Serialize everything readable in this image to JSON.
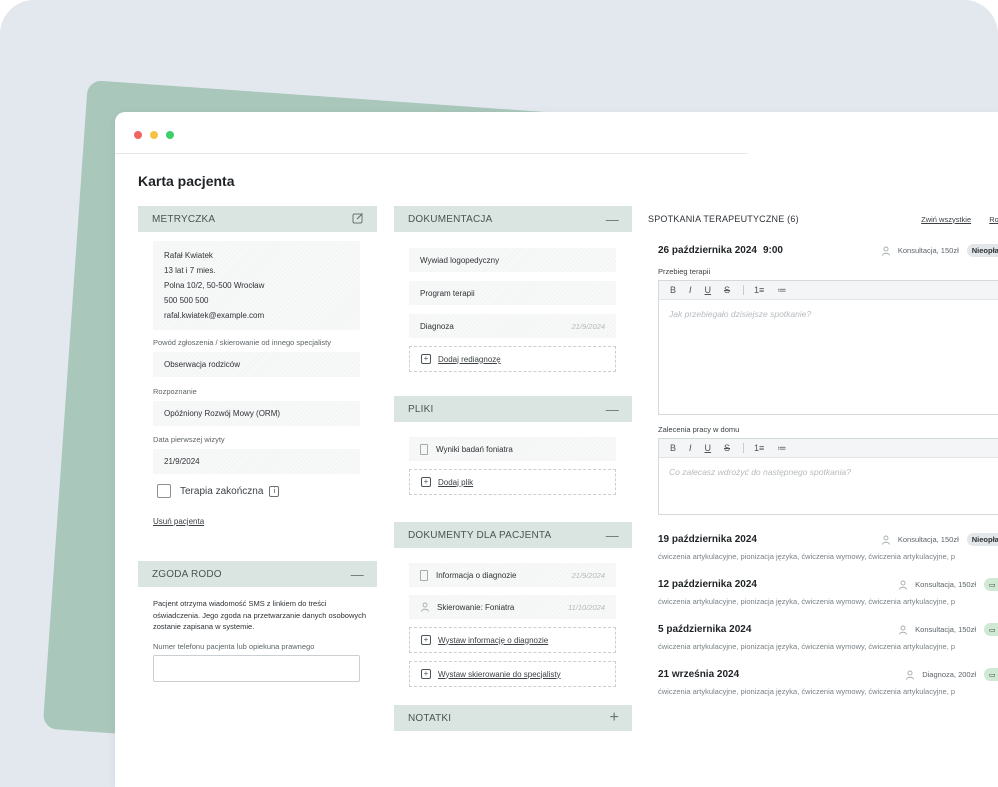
{
  "page_title": "Karta pacjenta",
  "metryczka": {
    "header": "METRYCZKA",
    "name": "Rafał Kwiatek",
    "age": "13 lat i 7 mies.",
    "address": "Polna 10/2, 50-500 Wrocław",
    "phone": "500 500 500",
    "email": "rafal.kwiatek@example.com",
    "reason_label": "Powód zgłoszenia / skierowanie od innego specjalisty",
    "reason_value": "Obserwacja rodziców",
    "diagnosis_label": "Rozpoznanie",
    "diagnosis_value": "Opóźniony Rozwój Mowy (ORM)",
    "first_visit_label": "Data pierwszej wizyty",
    "first_visit_value": "21/9/2024",
    "therapy_finished_label": "Terapia zakończna",
    "delete_link": "Usuń pacjenta"
  },
  "rodo": {
    "header": "ZGODA RODO",
    "text": "Pacjent otrzyma wiadomość SMS z linkiem do treści oświadczenia. Jego zgoda na przetwarzanie danych osobowych zostanie zapisana w systemie.",
    "phone_label": "Numer telefonu pacjenta lub opiekuna prawnego",
    "phone_value": ""
  },
  "dokumentacja": {
    "header": "DOKUMENTACJA",
    "items": [
      {
        "label": "Wywiad logopedyczny",
        "date": ""
      },
      {
        "label": "Program terapii",
        "date": ""
      },
      {
        "label": "Diagnoza",
        "date": "21/9/2024"
      }
    ],
    "add_label": "Dodaj rediagnozę"
  },
  "pliki": {
    "header": "PLIKI",
    "items": [
      {
        "label": "Wyniki badań foniatra"
      }
    ],
    "add_label": "Dodaj plik"
  },
  "dokumenty_pacjenta": {
    "header": "DOKUMENTY DLA PACJENTA",
    "items": [
      {
        "label": "Informacja o diagnozie",
        "date": "21/9/2024"
      },
      {
        "label": "Skierowanie: Foniatra",
        "date": "11/10/2024"
      }
    ],
    "add_info_label": "Wystaw informację o diagnozie",
    "add_referral_label": "Wystaw skierowanie do specjalisty"
  },
  "notatki": {
    "header": "NOTATKI"
  },
  "spotkania": {
    "header": "SPOTKANIA TERAPEUTYCZNE (6)",
    "collapse_all": "Zwiń wszystkie",
    "expand_all": "Rozw",
    "current": {
      "date": "26 października 2024",
      "time": "9:00",
      "meta": "Konsultacja, 150zł",
      "status": "Nieopłac",
      "progress_label": "Przebieg terapii",
      "progress_placeholder": "Jak przebiegało dzisiejsze spotkanie?",
      "homework_label": "Zalecenia pracy w domu",
      "homework_placeholder": "Co zalecasz wdrożyć do następnego spotkania?"
    },
    "toolbar": {
      "bold": "B",
      "italic": "I",
      "underline": "U",
      "strike": "S",
      "ol": "1≡",
      "ul": "≔"
    },
    "past": [
      {
        "date": "19 października 2024",
        "meta": "Konsultacja, 150zł",
        "status": "Nieopłac",
        "tags": "ćwiczenia artykulacyjne, pionizacja języka, ćwiczenia wymowy, ćwiczenia artykulacyjne, p"
      },
      {
        "date": "12 października 2024",
        "meta": "Konsultacja, 150zł",
        "status": "K",
        "tags": "ćwiczenia artykulacyjne, pionizacja języka, ćwiczenia wymowy, ćwiczenia artykulacyjne, p"
      },
      {
        "date": "5 października 2024",
        "meta": "Konsultacja, 150zł",
        "status": "K",
        "tags": "ćwiczenia artykulacyjne, pionizacja języka, ćwiczenia wymowy, ćwiczenia artykulacyjne, p"
      },
      {
        "date": "21 września 2024",
        "meta": "Diagnoza, 200zł",
        "status": "K",
        "tags": "ćwiczenia artykulacyjne, pionizacja języka, ćwiczenia wymowy, ćwiczenia artykulacyjne, p"
      }
    ]
  },
  "icons": {
    "edit": "edit-icon",
    "minus": "minus-icon",
    "plus": "plus-icon"
  },
  "colors": {
    "section_header_bg": "#dae5e2",
    "accent_green": "#a9c7bb",
    "paid_pill": "#cfe9d5"
  }
}
